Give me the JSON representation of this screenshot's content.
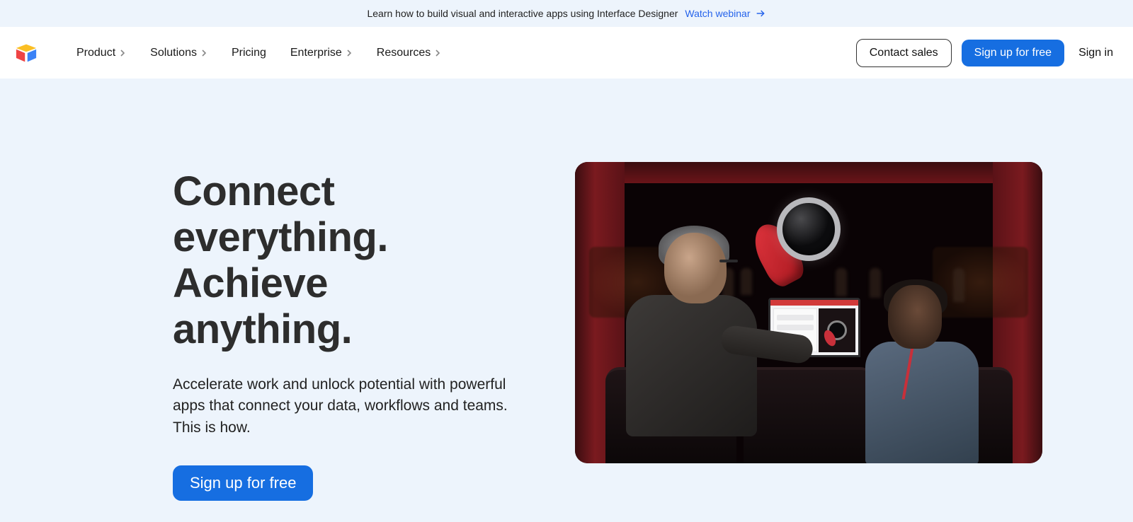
{
  "announcement": {
    "text": "Learn how to build visual and interactive apps using Interface Designer",
    "link_label": "Watch webinar"
  },
  "nav": {
    "items": [
      {
        "label": "Product",
        "has_dropdown": true
      },
      {
        "label": "Solutions",
        "has_dropdown": true
      },
      {
        "label": "Pricing",
        "has_dropdown": false
      },
      {
        "label": "Enterprise",
        "has_dropdown": true
      },
      {
        "label": "Resources",
        "has_dropdown": true
      }
    ],
    "contact_sales": "Contact sales",
    "signup": "Sign up for free",
    "signin": "Sign in"
  },
  "hero": {
    "title_line1": "Connect",
    "title_line2": "everything.",
    "title_line3": "Achieve",
    "title_line4": "anything.",
    "subtitle": "Accelerate work and unlock potential with powerful apps that connect your data, workflows and teams. This is how.",
    "cta": "Sign up for free"
  },
  "colors": {
    "primary": "#166ee1",
    "page_bg": "#edf4fc",
    "text": "#1a1a1a"
  }
}
